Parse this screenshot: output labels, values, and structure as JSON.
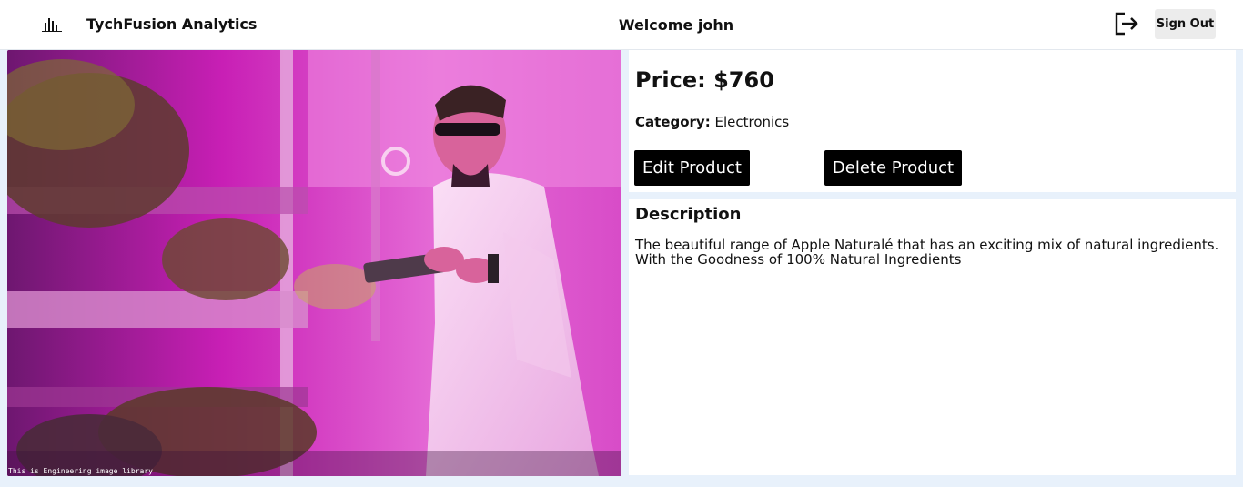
{
  "header": {
    "brand_icon": "bar-chart-icon",
    "brand_title": "TychFusion Analytics",
    "welcome": "Welcome john",
    "logout_icon": "logout-icon",
    "sign_out_label": "Sign Out"
  },
  "product": {
    "image_caption": "This is Engineering image library",
    "price": "Price: $760",
    "category_label": "Category:",
    "category_value": "Electronics",
    "edit_label": "Edit Product",
    "delete_label": "Delete Product",
    "description_title": "Description",
    "description_text": "The beautiful range of Apple Naturalé that has an exciting mix of natural ingredients. With the Goodness of 100% Natural Ingredients"
  },
  "colors": {
    "page_background": "#e8f1fb",
    "button_dark": "#000000",
    "image_tint": "#c21fb4"
  }
}
